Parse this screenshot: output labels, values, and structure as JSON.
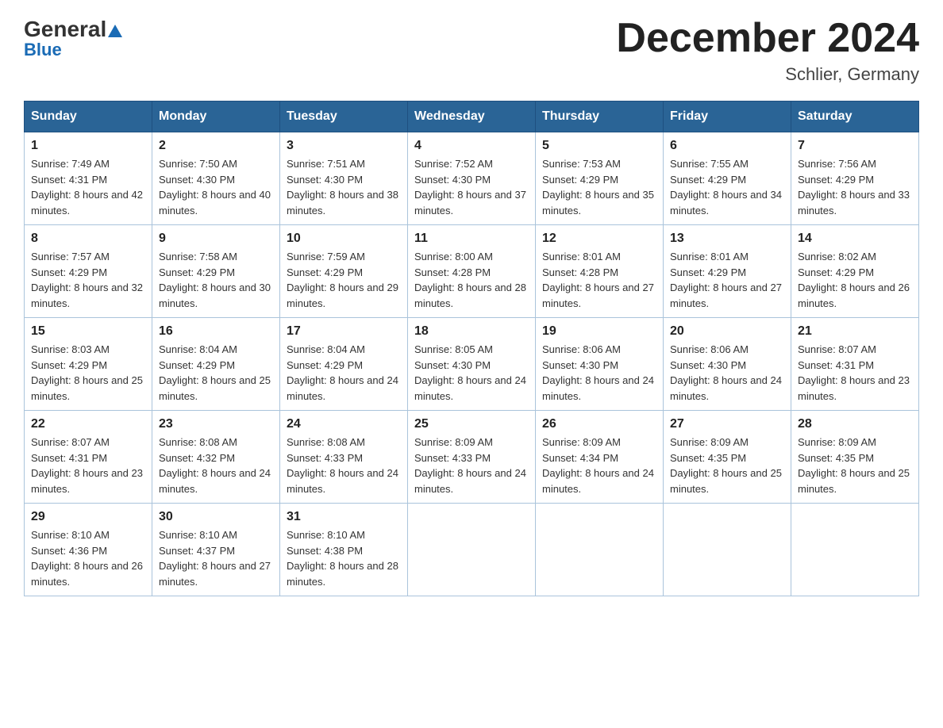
{
  "header": {
    "logo_general": "General",
    "logo_blue": "Blue",
    "month_year": "December 2024",
    "location": "Schlier, Germany"
  },
  "days_of_week": [
    "Sunday",
    "Monday",
    "Tuesday",
    "Wednesday",
    "Thursday",
    "Friday",
    "Saturday"
  ],
  "weeks": [
    [
      {
        "day": "1",
        "sunrise": "7:49 AM",
        "sunset": "4:31 PM",
        "daylight": "8 hours and 42 minutes."
      },
      {
        "day": "2",
        "sunrise": "7:50 AM",
        "sunset": "4:30 PM",
        "daylight": "8 hours and 40 minutes."
      },
      {
        "day": "3",
        "sunrise": "7:51 AM",
        "sunset": "4:30 PM",
        "daylight": "8 hours and 38 minutes."
      },
      {
        "day": "4",
        "sunrise": "7:52 AM",
        "sunset": "4:30 PM",
        "daylight": "8 hours and 37 minutes."
      },
      {
        "day": "5",
        "sunrise": "7:53 AM",
        "sunset": "4:29 PM",
        "daylight": "8 hours and 35 minutes."
      },
      {
        "day": "6",
        "sunrise": "7:55 AM",
        "sunset": "4:29 PM",
        "daylight": "8 hours and 34 minutes."
      },
      {
        "day": "7",
        "sunrise": "7:56 AM",
        "sunset": "4:29 PM",
        "daylight": "8 hours and 33 minutes."
      }
    ],
    [
      {
        "day": "8",
        "sunrise": "7:57 AM",
        "sunset": "4:29 PM",
        "daylight": "8 hours and 32 minutes."
      },
      {
        "day": "9",
        "sunrise": "7:58 AM",
        "sunset": "4:29 PM",
        "daylight": "8 hours and 30 minutes."
      },
      {
        "day": "10",
        "sunrise": "7:59 AM",
        "sunset": "4:29 PM",
        "daylight": "8 hours and 29 minutes."
      },
      {
        "day": "11",
        "sunrise": "8:00 AM",
        "sunset": "4:28 PM",
        "daylight": "8 hours and 28 minutes."
      },
      {
        "day": "12",
        "sunrise": "8:01 AM",
        "sunset": "4:28 PM",
        "daylight": "8 hours and 27 minutes."
      },
      {
        "day": "13",
        "sunrise": "8:01 AM",
        "sunset": "4:29 PM",
        "daylight": "8 hours and 27 minutes."
      },
      {
        "day": "14",
        "sunrise": "8:02 AM",
        "sunset": "4:29 PM",
        "daylight": "8 hours and 26 minutes."
      }
    ],
    [
      {
        "day": "15",
        "sunrise": "8:03 AM",
        "sunset": "4:29 PM",
        "daylight": "8 hours and 25 minutes."
      },
      {
        "day": "16",
        "sunrise": "8:04 AM",
        "sunset": "4:29 PM",
        "daylight": "8 hours and 25 minutes."
      },
      {
        "day": "17",
        "sunrise": "8:04 AM",
        "sunset": "4:29 PM",
        "daylight": "8 hours and 24 minutes."
      },
      {
        "day": "18",
        "sunrise": "8:05 AM",
        "sunset": "4:30 PM",
        "daylight": "8 hours and 24 minutes."
      },
      {
        "day": "19",
        "sunrise": "8:06 AM",
        "sunset": "4:30 PM",
        "daylight": "8 hours and 24 minutes."
      },
      {
        "day": "20",
        "sunrise": "8:06 AM",
        "sunset": "4:30 PM",
        "daylight": "8 hours and 24 minutes."
      },
      {
        "day": "21",
        "sunrise": "8:07 AM",
        "sunset": "4:31 PM",
        "daylight": "8 hours and 23 minutes."
      }
    ],
    [
      {
        "day": "22",
        "sunrise": "8:07 AM",
        "sunset": "4:31 PM",
        "daylight": "8 hours and 23 minutes."
      },
      {
        "day": "23",
        "sunrise": "8:08 AM",
        "sunset": "4:32 PM",
        "daylight": "8 hours and 24 minutes."
      },
      {
        "day": "24",
        "sunrise": "8:08 AM",
        "sunset": "4:33 PM",
        "daylight": "8 hours and 24 minutes."
      },
      {
        "day": "25",
        "sunrise": "8:09 AM",
        "sunset": "4:33 PM",
        "daylight": "8 hours and 24 minutes."
      },
      {
        "day": "26",
        "sunrise": "8:09 AM",
        "sunset": "4:34 PM",
        "daylight": "8 hours and 24 minutes."
      },
      {
        "day": "27",
        "sunrise": "8:09 AM",
        "sunset": "4:35 PM",
        "daylight": "8 hours and 25 minutes."
      },
      {
        "day": "28",
        "sunrise": "8:09 AM",
        "sunset": "4:35 PM",
        "daylight": "8 hours and 25 minutes."
      }
    ],
    [
      {
        "day": "29",
        "sunrise": "8:10 AM",
        "sunset": "4:36 PM",
        "daylight": "8 hours and 26 minutes."
      },
      {
        "day": "30",
        "sunrise": "8:10 AM",
        "sunset": "4:37 PM",
        "daylight": "8 hours and 27 minutes."
      },
      {
        "day": "31",
        "sunrise": "8:10 AM",
        "sunset": "4:38 PM",
        "daylight": "8 hours and 28 minutes."
      },
      null,
      null,
      null,
      null
    ]
  ]
}
